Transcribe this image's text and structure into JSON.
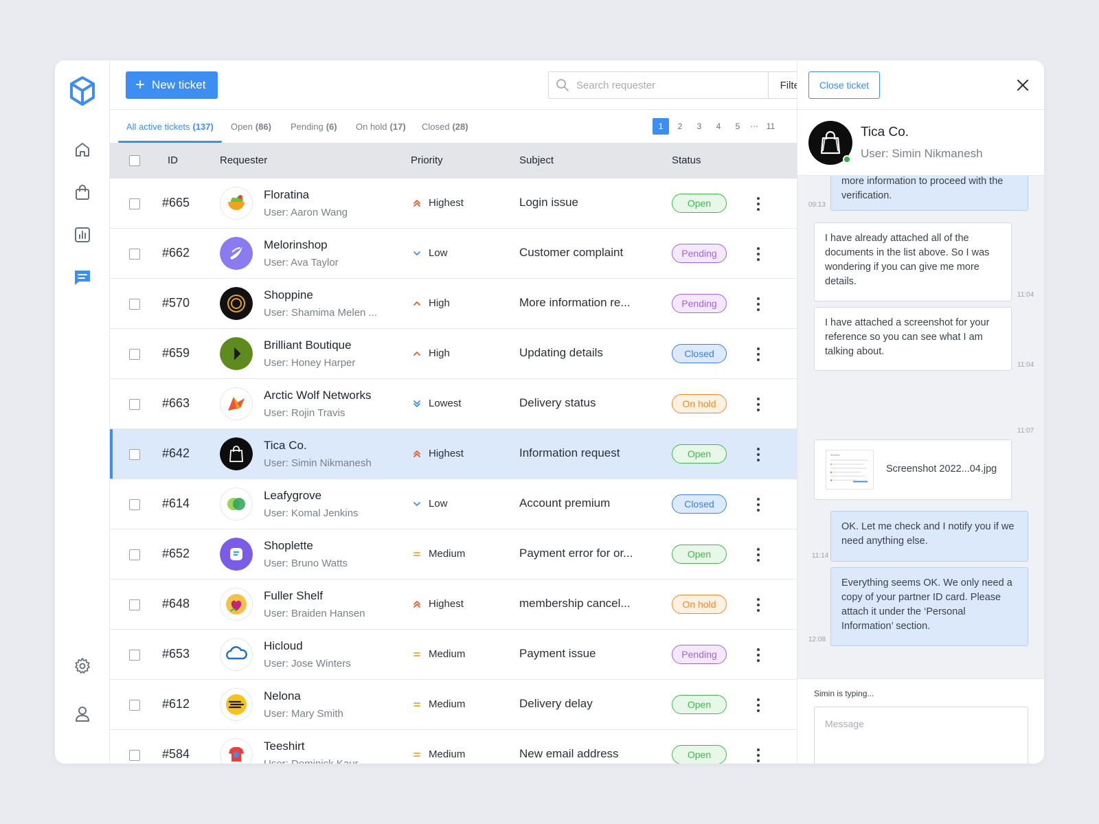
{
  "toolbar": {
    "new_ticket_label": "New ticket",
    "search_placeholder": "Search requester",
    "filters_label": "Filters"
  },
  "tabs": [
    {
      "label": "All active tickets",
      "count": "(137)",
      "active": true
    },
    {
      "label": "Open",
      "count": "(86)"
    },
    {
      "label": "Pending",
      "count": "(6)"
    },
    {
      "label": "On hold",
      "count": "(17)"
    },
    {
      "label": "Closed",
      "count": "(28)"
    }
  ],
  "pagination": [
    "1",
    "2",
    "3",
    "4",
    "5",
    "⋯",
    "11"
  ],
  "pagination_current": "1",
  "columns": {
    "id": "ID",
    "requester": "Requester",
    "priority": "Priority",
    "subject": "Subject",
    "status": "Status"
  },
  "tickets": [
    {
      "id": "#665",
      "name": "Floratina",
      "user": "User: Aaron Wang",
      "priority": "Highest",
      "subject": "Login issue",
      "status": "Open",
      "avatar": "floratina-logo"
    },
    {
      "id": "#662",
      "name": "Melorinshop",
      "user": "User: Ava Taylor",
      "priority": "Low",
      "subject": "Customer complaint",
      "status": "Pending",
      "avatar": "melorinshop-logo"
    },
    {
      "id": "#570",
      "name": "Shoppine",
      "user": "User: Shamima Melen ...",
      "priority": "High",
      "subject": "More information re...",
      "status": "Pending",
      "avatar": "shoppine-logo"
    },
    {
      "id": "#659",
      "name": "Brilliant Boutique",
      "user": "User: Honey Harper",
      "priority": "High",
      "subject": "Updating details",
      "status": "Closed",
      "avatar": "brilliant-boutique-logo"
    },
    {
      "id": "#663",
      "name": "Arctic Wolf Networks",
      "user": "User: Rojin Travis",
      "priority": "Lowest",
      "subject": "Delivery status",
      "status": "On hold",
      "avatar": "arctic-wolf-logo"
    },
    {
      "id": "#642",
      "name": "Tica Co.",
      "user": "User: Simin Nikmanesh",
      "priority": "Highest",
      "subject": "Information request",
      "status": "Open",
      "avatar": "tica-logo",
      "selected": true
    },
    {
      "id": "#614",
      "name": "Leafygrove",
      "user": "User: Komal Jenkins",
      "priority": "Low",
      "subject": "Account premium",
      "status": "Closed",
      "avatar": "leafygrove-logo"
    },
    {
      "id": "#652",
      "name": "Shoplette",
      "user": "User: Bruno Watts",
      "priority": "Medium",
      "subject": "Payment error for or...",
      "status": "Open",
      "avatar": "shoplette-logo"
    },
    {
      "id": "#648",
      "name": "Fuller Shelf",
      "user": "User: Braiden Hansen",
      "priority": "Highest",
      "subject": "membership cancel...",
      "status": "On hold",
      "avatar": "fuller-shelf-logo"
    },
    {
      "id": "#653",
      "name": "Hicloud",
      "user": "User: Jose Winters",
      "priority": "Medium",
      "subject": "Payment issue",
      "status": "Pending",
      "avatar": "hicloud-logo"
    },
    {
      "id": "#612",
      "name": "Nelona",
      "user": "User: Mary Smith",
      "priority": "Medium",
      "subject": "Delivery delay",
      "status": "Open",
      "avatar": "nelona-logo"
    },
    {
      "id": "#584",
      "name": "Teeshirt",
      "user": "User: Dominick Kaur",
      "priority": "Medium",
      "subject": "New email address",
      "status": "Open",
      "avatar": "teeshirt-logo"
    }
  ],
  "panel": {
    "close_ticket_label": "Close ticket",
    "name": "Tica Co.",
    "user": "User: Simin Nikmanesh",
    "messages": [
      {
        "dir": "out",
        "text": "more information to proceed with the verification.",
        "time": "09:13"
      },
      {
        "dir": "in",
        "text": "I have already attached all of the documents in the list above. So I was wondering if you can give me more details.",
        "time": "11:04"
      },
      {
        "dir": "in",
        "text": "I have attached a screenshot for your reference so you can see what I am talking about.",
        "time": "11:04"
      },
      {
        "dir": "in",
        "file": "Screenshot 2022...04.jpg",
        "time": "11:07"
      },
      {
        "dir": "out",
        "text": "OK. Let me check and I notify you if we need anything else.",
        "time": "11:14"
      },
      {
        "dir": "out",
        "text": "Everything seems OK. We only need a copy of your partner ID card. Please attach it under the ‘Personal Information’ section.",
        "time": "12:08"
      }
    ],
    "typing": "Simin is typing...",
    "message_placeholder": "Message"
  },
  "colors": {
    "accent": "#3d8ef2",
    "open": "#3fb94c",
    "pending": "#a463de",
    "closed": "#3d7fe0",
    "on_hold": "#ef8a2a",
    "priority_up": "#f0562b",
    "priority_down": "#3d8ef2",
    "priority_medium": "#f3a21b"
  },
  "icons": [
    "cube-logo-icon",
    "home-icon",
    "shopping-bag-icon",
    "chart-icon",
    "chat-icon",
    "gear-icon",
    "user-icon",
    "search-icon",
    "chevron-down-icon",
    "close-icon",
    "paperclip-icon",
    "send-icon"
  ]
}
